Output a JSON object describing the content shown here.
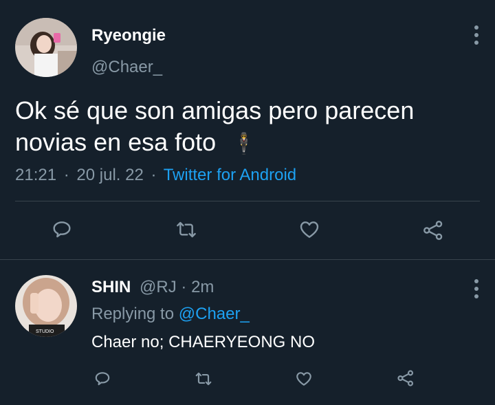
{
  "tweet": {
    "author_name": "Ryeongie",
    "handle": "@Chaer_",
    "text_line1": "Ok sé que son amigas pero parecen",
    "text_line2": "novias en esa foto",
    "emoji": "🕴",
    "time": "21:21",
    "date": "20 jul. 22",
    "source": "Twitter for Android",
    "separator": "·"
  },
  "reply": {
    "author_name": "SHIN",
    "handle": "@RJ",
    "age": "2m",
    "separator": "·",
    "replying_prefix": "Replying to",
    "replying_handle": "@Chaer_",
    "text": "Chaer no; CHAERYEONG NO"
  },
  "icons": {
    "reply": "reply-icon",
    "retweet": "retweet-icon",
    "like": "heart-icon",
    "share": "share-icon",
    "more": "more-vertical-icon"
  },
  "colors": {
    "background": "#15202b",
    "text": "#ffffff",
    "muted": "#8899a6",
    "link": "#1da1f2",
    "divider": "#38444d"
  }
}
